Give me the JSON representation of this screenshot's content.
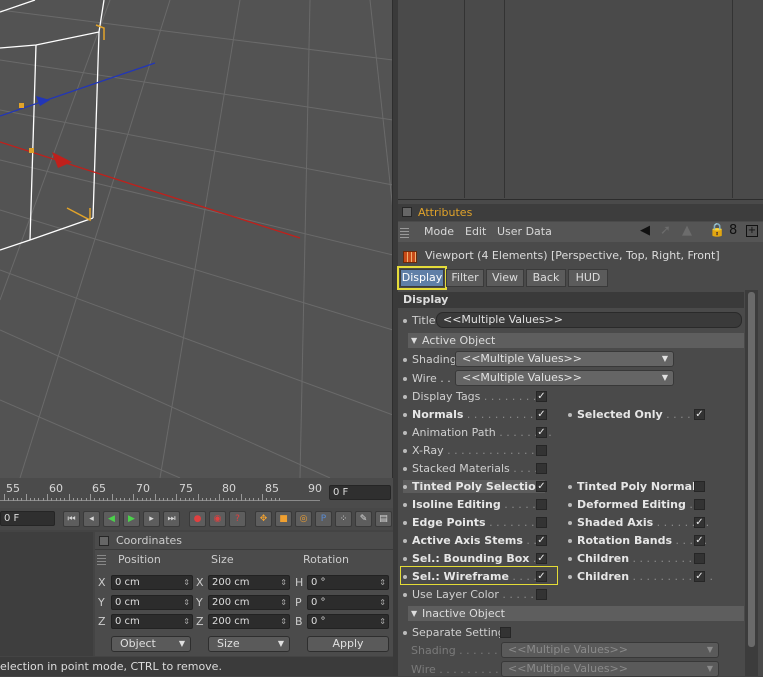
{
  "timeline": {
    "ticks": [
      "55",
      "60",
      "65",
      "70",
      "75",
      "80",
      "85",
      "90"
    ],
    "current_frame": "0 F",
    "end_frame": "0 F"
  },
  "coords": {
    "title": "Coordinates",
    "headers": [
      "Position",
      "Size",
      "Rotation"
    ],
    "rows": [
      {
        "axis": "X",
        "pos": "0 cm",
        "size_axis": "X",
        "size": "200 cm",
        "rot_axis": "H",
        "rot": "0 °"
      },
      {
        "axis": "Y",
        "pos": "0 cm",
        "size_axis": "Y",
        "size": "200 cm",
        "rot_axis": "P",
        "rot": "0 °"
      },
      {
        "axis": "Z",
        "pos": "0 cm",
        "size_axis": "Z",
        "size": "200 cm",
        "rot_axis": "B",
        "rot": "0 °"
      }
    ],
    "mode_dropdown": "Object",
    "size_dropdown": "Size",
    "apply_label": "Apply"
  },
  "status": "election in point mode, CTRL to remove.",
  "attributes": {
    "title": "Attributes",
    "menu": [
      "Mode",
      "Edit",
      "User Data"
    ],
    "object_line": "Viewport (4 Elements) [Perspective, Top, Right, Front]",
    "tabs": [
      "Display",
      "Filter",
      "View",
      "Back",
      "HUD"
    ],
    "section_display": "Display",
    "title_label": "Title",
    "title_value": "<<Multiple Values>>",
    "active_object": "Active Object",
    "shading_label": "Shading",
    "shading_value": "<<Multiple Values>>",
    "wire_label": "Wire . . .",
    "wire_value": "<<Multiple Values>>",
    "left_rows": [
      {
        "label": "Display Tags",
        "dots": " . . . . . . . . .",
        "bold": false
      },
      {
        "label": "Normals",
        "dots": " . . . . . . . . . . .",
        "bold": true
      },
      {
        "label": "Animation Path",
        "dots": " . . . . . . . .",
        "bold": false
      },
      {
        "label": "X-Ray",
        "dots": " . . . . . . . . . . . . .",
        "bold": false
      },
      {
        "label": "Stacked Materials",
        "dots": " . . . . .",
        "bold": false
      },
      {
        "label": "Tinted Poly Selection",
        "dots": "",
        "bold": true
      },
      {
        "label": "Isoline Editing",
        "dots": " . . . . . .",
        "bold": true
      },
      {
        "label": "Edge Points",
        "dots": " . . . . . . . .",
        "bold": true
      },
      {
        "label": "Active Axis Stems",
        "dots": " . . .",
        "bold": true
      },
      {
        "label": "Sel.: Bounding Box",
        "dots": " . .",
        "bold": true
      },
      {
        "label": "Sel.: Wireframe",
        "dots": " . . . . .",
        "bold": true
      },
      {
        "label": "Use Layer Color",
        "dots": " . . . . . .",
        "bold": false
      }
    ],
    "right_rows": [
      {
        "label": "Selected Only",
        "dots": " . . . . ."
      },
      {
        "label": "Tinted Poly Normals",
        "dots": ""
      },
      {
        "label": "Deformed Editing",
        "dots": " . ."
      },
      {
        "label": "Shaded Axis",
        "dots": " . . . . . . . ."
      },
      {
        "label": "Rotation Bands",
        "dots": " . . . . ."
      },
      {
        "label": "Children",
        "dots": " . . . . . . . . . . ."
      },
      {
        "label": "Children",
        "dots": " . . . . . . . . . . . ."
      }
    ],
    "inactive_object": "Inactive Object",
    "separate_settings": "Separate Settings",
    "shading2_label": "Shading . . . . . . .",
    "shading2_value": "<<Multiple Values>>",
    "wire2_label": "Wire . . . . . . . . . .",
    "wire2_value": "<<Multiple Values>>"
  },
  "colors": {
    "accent": "#e1a32a",
    "highlight": "#e4dc36",
    "axis_x": "#c0201b",
    "axis_z": "#2236b8"
  }
}
